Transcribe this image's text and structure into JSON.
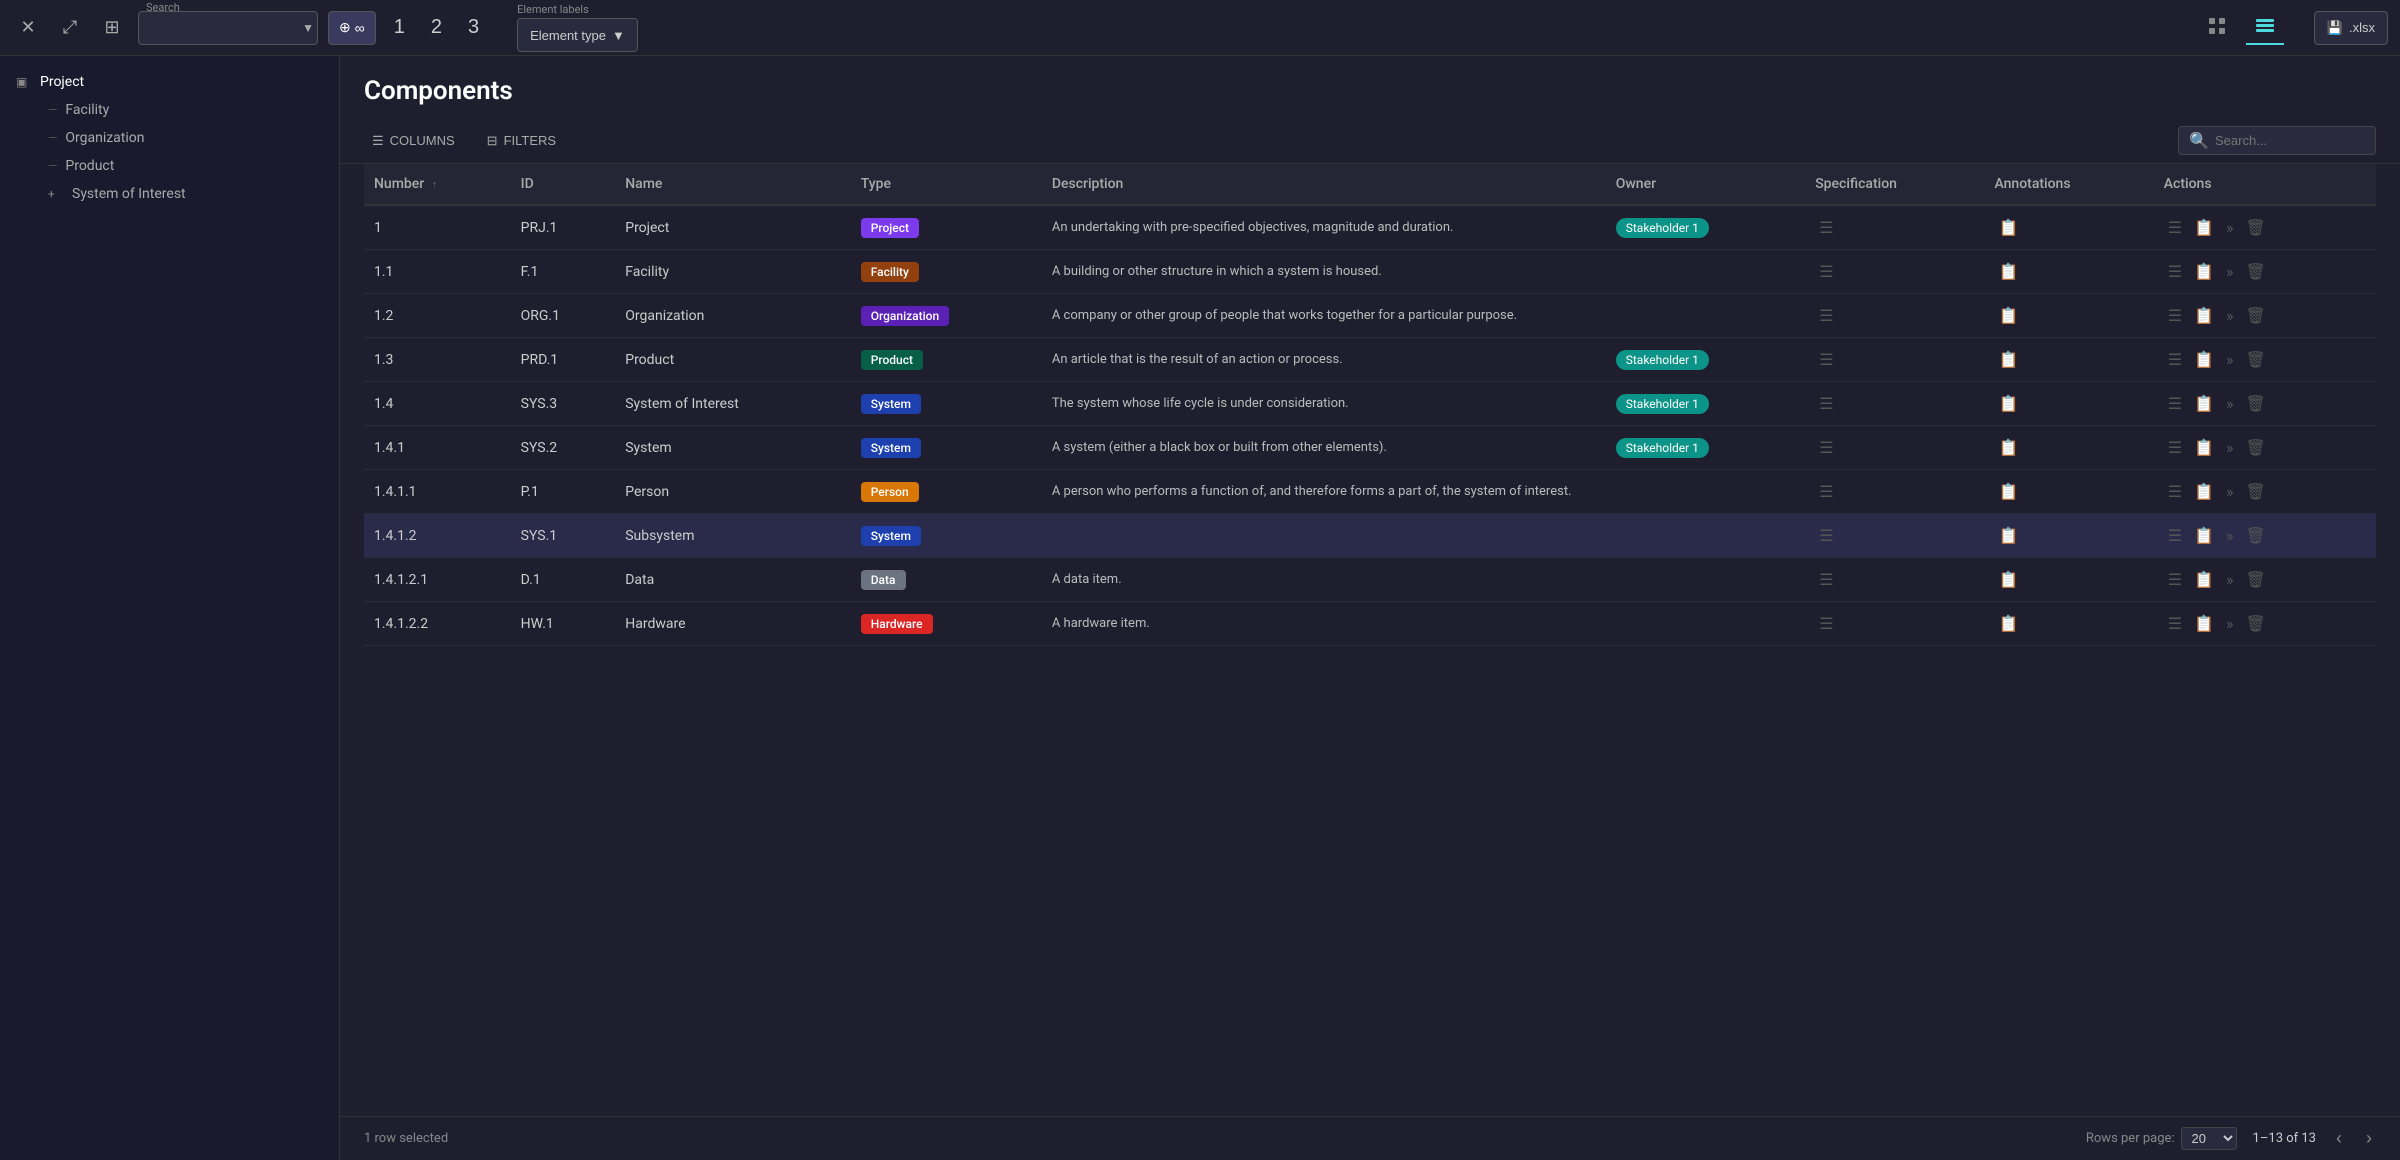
{
  "topbar": {
    "close_icon": "✕",
    "expand_icon": "⤢",
    "pin_icon": "⊞",
    "search_label": "Search",
    "search_placeholder": "",
    "layer_btn_label": "∞",
    "num1": "1",
    "num2": "2",
    "num3": "3",
    "element_labels_label": "Element labels",
    "element_type_label": "Element type",
    "view_tree_icon": "⊞",
    "view_table_icon": "☰",
    "export_label": ".xlsx"
  },
  "sidebar": {
    "items": [
      {
        "id": "project",
        "label": "Project",
        "icon": "▣",
        "indent": 0,
        "toggle": "▣"
      },
      {
        "id": "facility",
        "label": "Facility",
        "indent": 1,
        "dash": "—"
      },
      {
        "id": "organization",
        "label": "Organization",
        "indent": 1,
        "dash": "—"
      },
      {
        "id": "product",
        "label": "Product",
        "indent": 1,
        "dash": "—"
      },
      {
        "id": "system-of-interest",
        "label": "System of Interest",
        "indent": 1,
        "toggle": "+"
      }
    ]
  },
  "content": {
    "title": "Components",
    "toolbar": {
      "columns_label": "COLUMNS",
      "filters_label": "FILTERS",
      "search_placeholder": "Search..."
    },
    "table": {
      "columns": [
        {
          "id": "number",
          "label": "Number",
          "sort": "↑"
        },
        {
          "id": "id",
          "label": "ID"
        },
        {
          "id": "name",
          "label": "Name"
        },
        {
          "id": "type",
          "label": "Type"
        },
        {
          "id": "description",
          "label": "Description"
        },
        {
          "id": "owner",
          "label": "Owner"
        },
        {
          "id": "specification",
          "label": "Specification"
        },
        {
          "id": "annotations",
          "label": "Annotations"
        },
        {
          "id": "actions",
          "label": "Actions"
        }
      ],
      "rows": [
        {
          "number": "1",
          "id": "PRJ.1",
          "name": "Project",
          "type": "Project",
          "type_class": "badge-project",
          "description": "An undertaking with pre-specified objectives, magnitude and duration.",
          "owner": "Stakeholder 1",
          "selected": false
        },
        {
          "number": "1.1",
          "id": "F.1",
          "name": "Facility",
          "type": "Facility",
          "type_class": "badge-facility",
          "description": "A building or other structure in which a system is housed.",
          "owner": "",
          "selected": false
        },
        {
          "number": "1.2",
          "id": "ORG.1",
          "name": "Organization",
          "type": "Organization",
          "type_class": "badge-organization",
          "description": "A company or other group of people that works together for a particular purpose.",
          "owner": "",
          "selected": false
        },
        {
          "number": "1.3",
          "id": "PRD.1",
          "name": "Product",
          "type": "Product",
          "type_class": "badge-product",
          "description": "An article that is the result of an action or process.",
          "owner": "Stakeholder 1",
          "selected": false
        },
        {
          "number": "1.4",
          "id": "SYS.3",
          "name": "System of Interest",
          "type": "System",
          "type_class": "badge-system",
          "description": "The system whose life cycle is under consideration.",
          "owner": "Stakeholder 1",
          "selected": false
        },
        {
          "number": "1.4.1",
          "id": "SYS.2",
          "name": "System",
          "type": "System",
          "type_class": "badge-system",
          "description": "A system (either a black box or built from other elements).",
          "owner": "Stakeholder 1",
          "selected": false
        },
        {
          "number": "1.4.1.1",
          "id": "P.1",
          "name": "Person",
          "type": "Person",
          "type_class": "badge-person",
          "description": "A person who performs a function of, and therefore forms a part of, the system of interest.",
          "owner": "",
          "selected": false
        },
        {
          "number": "1.4.1.2",
          "id": "SYS.1",
          "name": "Subsystem",
          "type": "System",
          "type_class": "badge-system",
          "description": "",
          "owner": "",
          "selected": true
        },
        {
          "number": "1.4.1.2.1",
          "id": "D.1",
          "name": "Data",
          "type": "Data",
          "type_class": "badge-data",
          "description": "A data item.",
          "owner": "",
          "selected": false
        },
        {
          "number": "1.4.1.2.2",
          "id": "HW.1",
          "name": "Hardware",
          "type": "Hardware",
          "type_class": "badge-hardware",
          "description": "A hardware item.",
          "owner": "",
          "selected": false
        }
      ]
    },
    "footer": {
      "selected_text": "1 row selected",
      "rows_per_page_label": "Rows per page:",
      "rows_per_page_value": "20",
      "pagination_info": "1–13 of 13"
    }
  }
}
